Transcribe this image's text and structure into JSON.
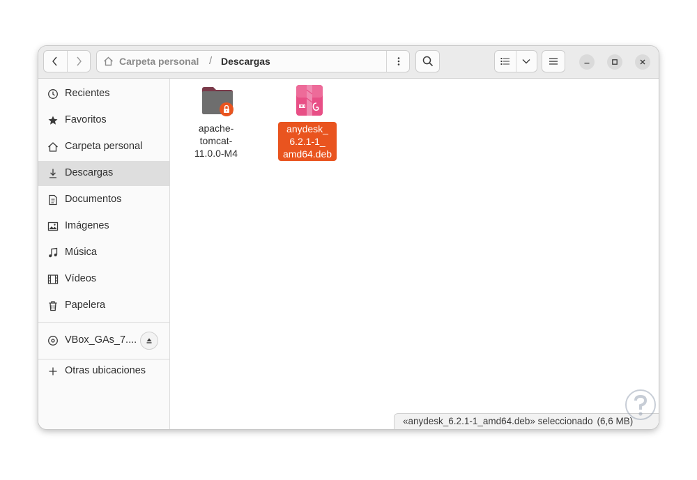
{
  "window": {
    "path": [
      "Carpeta personal",
      "Descargas"
    ],
    "path_separator": "/"
  },
  "sidebar": {
    "places": [
      {
        "label": "Recientes",
        "icon": "clock-icon",
        "active": false
      },
      {
        "label": "Favoritos",
        "icon": "star-icon",
        "active": false
      },
      {
        "label": "Carpeta personal",
        "icon": "home-icon",
        "active": false
      },
      {
        "label": "Descargas",
        "icon": "download-icon",
        "active": true
      },
      {
        "label": "Documentos",
        "icon": "document-icon",
        "active": false
      },
      {
        "label": "Imágenes",
        "icon": "image-icon",
        "active": false
      },
      {
        "label": "Música",
        "icon": "music-icon",
        "active": false
      },
      {
        "label": "Vídeos",
        "icon": "film-icon",
        "active": false
      },
      {
        "label": "Papelera",
        "icon": "trash-icon",
        "active": false
      }
    ],
    "device": {
      "label": "VBox_GAs_7....",
      "icon": "disc-icon"
    },
    "other_locations": {
      "label": "Otras ubicaciones",
      "icon": "plus-icon"
    }
  },
  "files": [
    {
      "name_lines": [
        "apache-",
        "tomcat-",
        "11.0.0-M4"
      ],
      "icon": "locked-folder-icon",
      "selected": false
    },
    {
      "name_lines": [
        "anydesk_",
        "6.2.1-1_",
        "amd64.deb"
      ],
      "icon": "debian-package-icon",
      "selected": true
    }
  ],
  "status": {
    "text": "«anydesk_6.2.1-1_amd64.deb» seleccionado",
    "size": "(6,6 MB)"
  },
  "colors": {
    "accent": "#e9541f",
    "headerbar": "#ebebeb",
    "sidebar": "#fafafa",
    "sidebar_active": "#dedede",
    "package_pink": "#e84f86"
  }
}
